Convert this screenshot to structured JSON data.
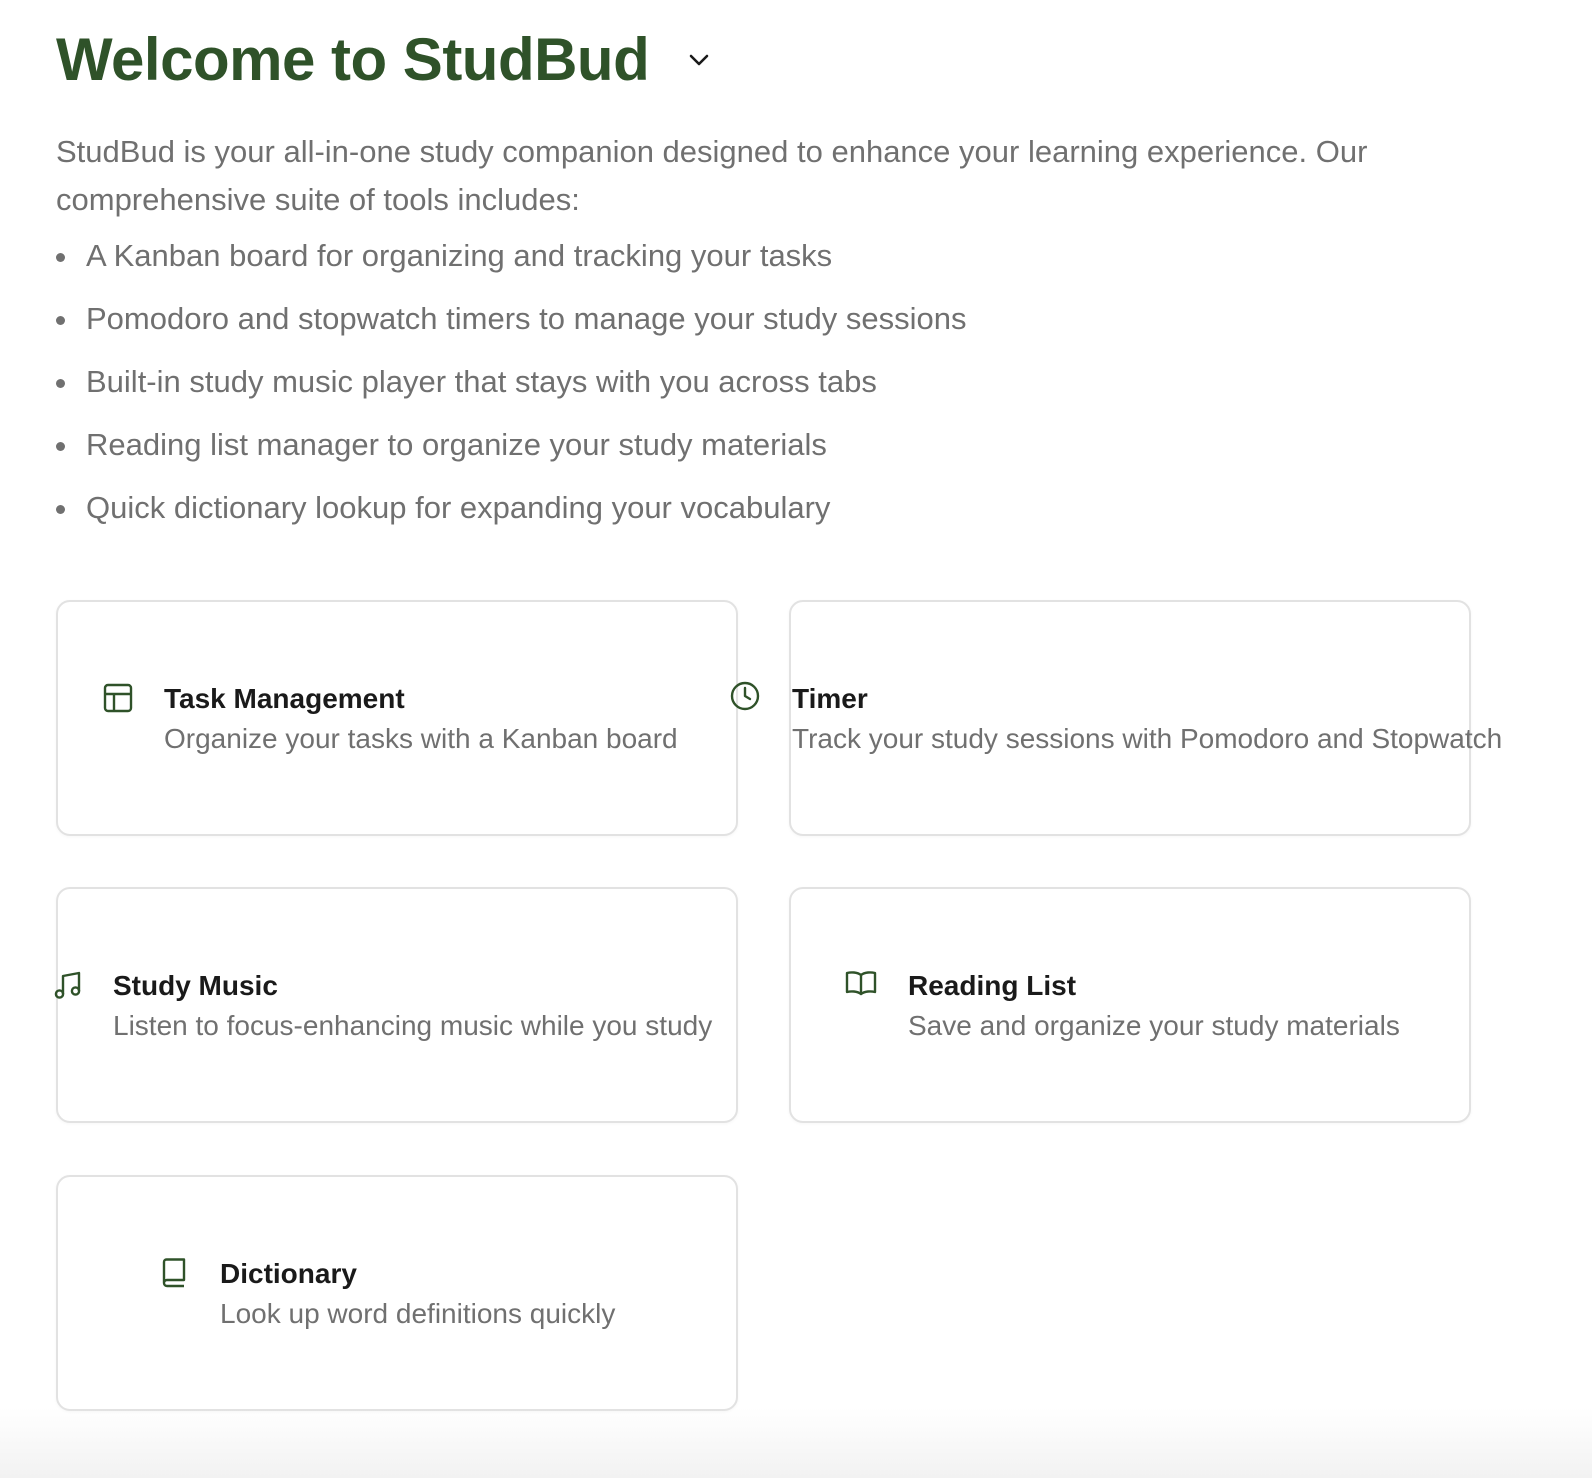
{
  "header": {
    "title": "Welcome to StudBud"
  },
  "intro": "StudBud is your all-in-one study companion designed to enhance your learning experience. Our comprehensive suite of tools includes:",
  "features": [
    "A Kanban board for organizing and tracking your tasks",
    "Pomodoro and stopwatch timers to manage your study sessions",
    "Built-in study music player that stays with you across tabs",
    "Reading list manager to organize your study materials",
    "Quick dictionary lookup for expanding your vocabulary"
  ],
  "cards": [
    {
      "icon": "layout-icon",
      "title": "Task Management",
      "description": "Organize your tasks with a Kanban board"
    },
    {
      "icon": "clock-icon",
      "title": "Timer",
      "description": "Track your study sessions with Pomodoro and Stopwatch"
    },
    {
      "icon": "music-note-icon",
      "title": "Study Music",
      "description": "Listen to focus-enhancing music while you study"
    },
    {
      "icon": "open-book-icon",
      "title": "Reading List",
      "description": "Save and organize your study materials"
    },
    {
      "icon": "book-icon",
      "title": "Dictionary",
      "description": "Look up word definitions quickly"
    }
  ],
  "colors": {
    "accent": "#2f5229",
    "body_text": "#707070",
    "card_border": "#e2e2e2"
  }
}
